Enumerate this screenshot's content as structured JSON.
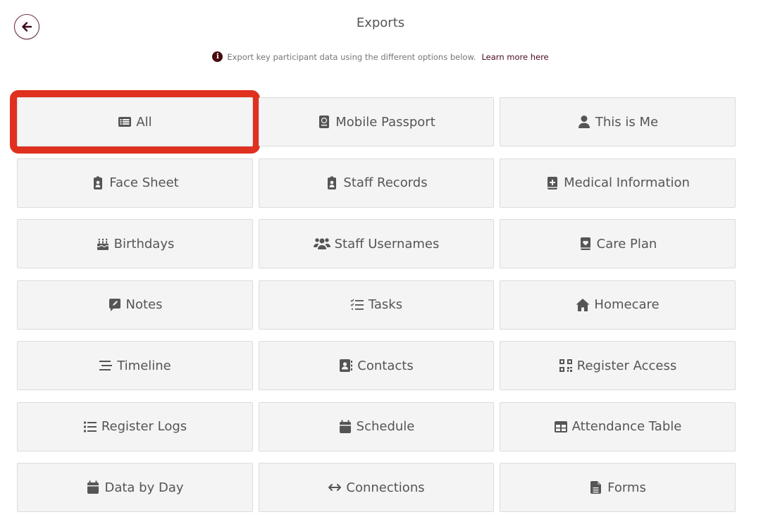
{
  "header": {
    "title": "Exports",
    "info_text": "Export key participant data using the different options below.",
    "info_link": "Learn more here"
  },
  "exports": [
    {
      "label": "All",
      "icon": "list-card-icon"
    },
    {
      "label": "Mobile Passport",
      "icon": "passport-icon"
    },
    {
      "label": "This is Me",
      "icon": "user-icon"
    },
    {
      "label": "Face Sheet",
      "icon": "id-badge-icon"
    },
    {
      "label": "Staff Records",
      "icon": "id-badge-icon"
    },
    {
      "label": "Medical Information",
      "icon": "medical-book-icon"
    },
    {
      "label": "Birthdays",
      "icon": "birthday-cake-icon"
    },
    {
      "label": "Staff Usernames",
      "icon": "users-icon"
    },
    {
      "label": "Care Plan",
      "icon": "heart-book-icon"
    },
    {
      "label": "Notes",
      "icon": "comment-pen-icon"
    },
    {
      "label": "Tasks",
      "icon": "list-check-icon"
    },
    {
      "label": "Homecare",
      "icon": "home-icon"
    },
    {
      "label": "Timeline",
      "icon": "bars-staggered-icon"
    },
    {
      "label": "Contacts",
      "icon": "address-book-icon"
    },
    {
      "label": "Register Access",
      "icon": "qrcode-icon"
    },
    {
      "label": "Register Logs",
      "icon": "list-ul-icon"
    },
    {
      "label": "Schedule",
      "icon": "calendar-icon"
    },
    {
      "label": "Attendance Table",
      "icon": "table-icon"
    },
    {
      "label": "Data by Day",
      "icon": "calendar-day-icon"
    },
    {
      "label": "Connections",
      "icon": "arrows-left-right-icon"
    },
    {
      "label": "Forms",
      "icon": "file-lines-icon"
    }
  ],
  "colors": {
    "accent": "#6b2a45",
    "highlight": "#e03020",
    "tile_bg": "#f4f4f4"
  }
}
